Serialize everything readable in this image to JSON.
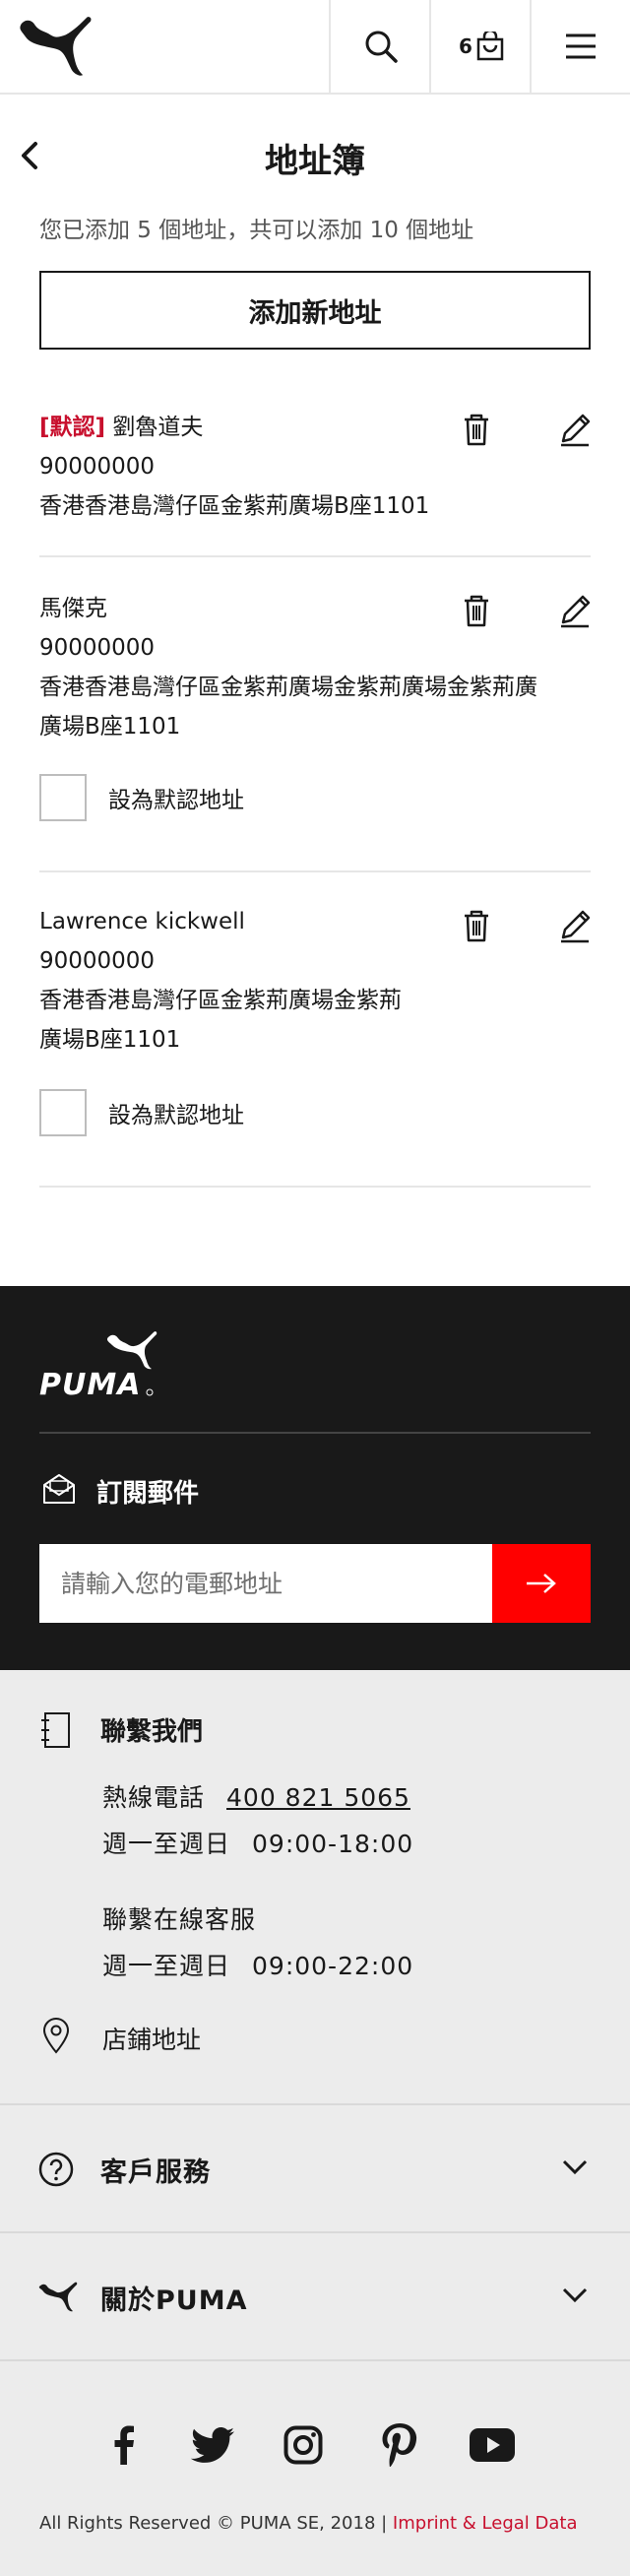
{
  "header": {
    "cart_count": "6",
    "icons": [
      "puma-logo",
      "search-icon",
      "cart-icon",
      "menu-icon"
    ]
  },
  "page": {
    "title": "地址簿",
    "count_info": "您已添加 5 個地址，共可以添加 10 個地址",
    "add_button": "添加新地址"
  },
  "addresses": [
    {
      "default_tag": "[默認]",
      "name": "劉魯道夫",
      "phone": "90000000",
      "address_lines": [
        "香港香港島灣仔區金紫荊廣場B座1101"
      ],
      "is_default": true
    },
    {
      "name": "馬傑克",
      "phone": "90000000",
      "address_lines": [
        "香港香港島灣仔區金紫荊廣場金紫荊廣場金紫荊廣",
        "廣場B座1101"
      ],
      "set_default_label": "設為默認地址",
      "is_default": false
    },
    {
      "name": "Lawrence kickwell",
      "phone": "90000000",
      "address_lines": [
        "香港香港島灣仔區金紫荊廣場金紫荊",
        "廣場B座1101"
      ],
      "set_default_label": "設為默認地址",
      "is_default": false
    }
  ],
  "newsletter": {
    "title": "訂閱郵件",
    "placeholder": "請輸入您的電郵地址"
  },
  "contact": {
    "title": "聯繫我們",
    "hotline_label": "熱線電話",
    "hotline_number": "400 821 5065",
    "hotline_days": "週一至週日",
    "hotline_hours": "09:00-18:00",
    "online_service": "聯繫在線客服",
    "online_days": "週一至週日",
    "online_hours": "09:00-22:00",
    "store_label": "店鋪地址"
  },
  "accordion": {
    "customer_service": "客戶服務",
    "about": "關於PUMA"
  },
  "social": [
    "facebook-icon",
    "twitter-icon",
    "instagram-icon",
    "pinterest-icon",
    "youtube-icon"
  ],
  "footer": {
    "copyright": "All Rights Reserved © PUMA SE, 2018 | ",
    "imprint": "Imprint & Legal Data"
  }
}
